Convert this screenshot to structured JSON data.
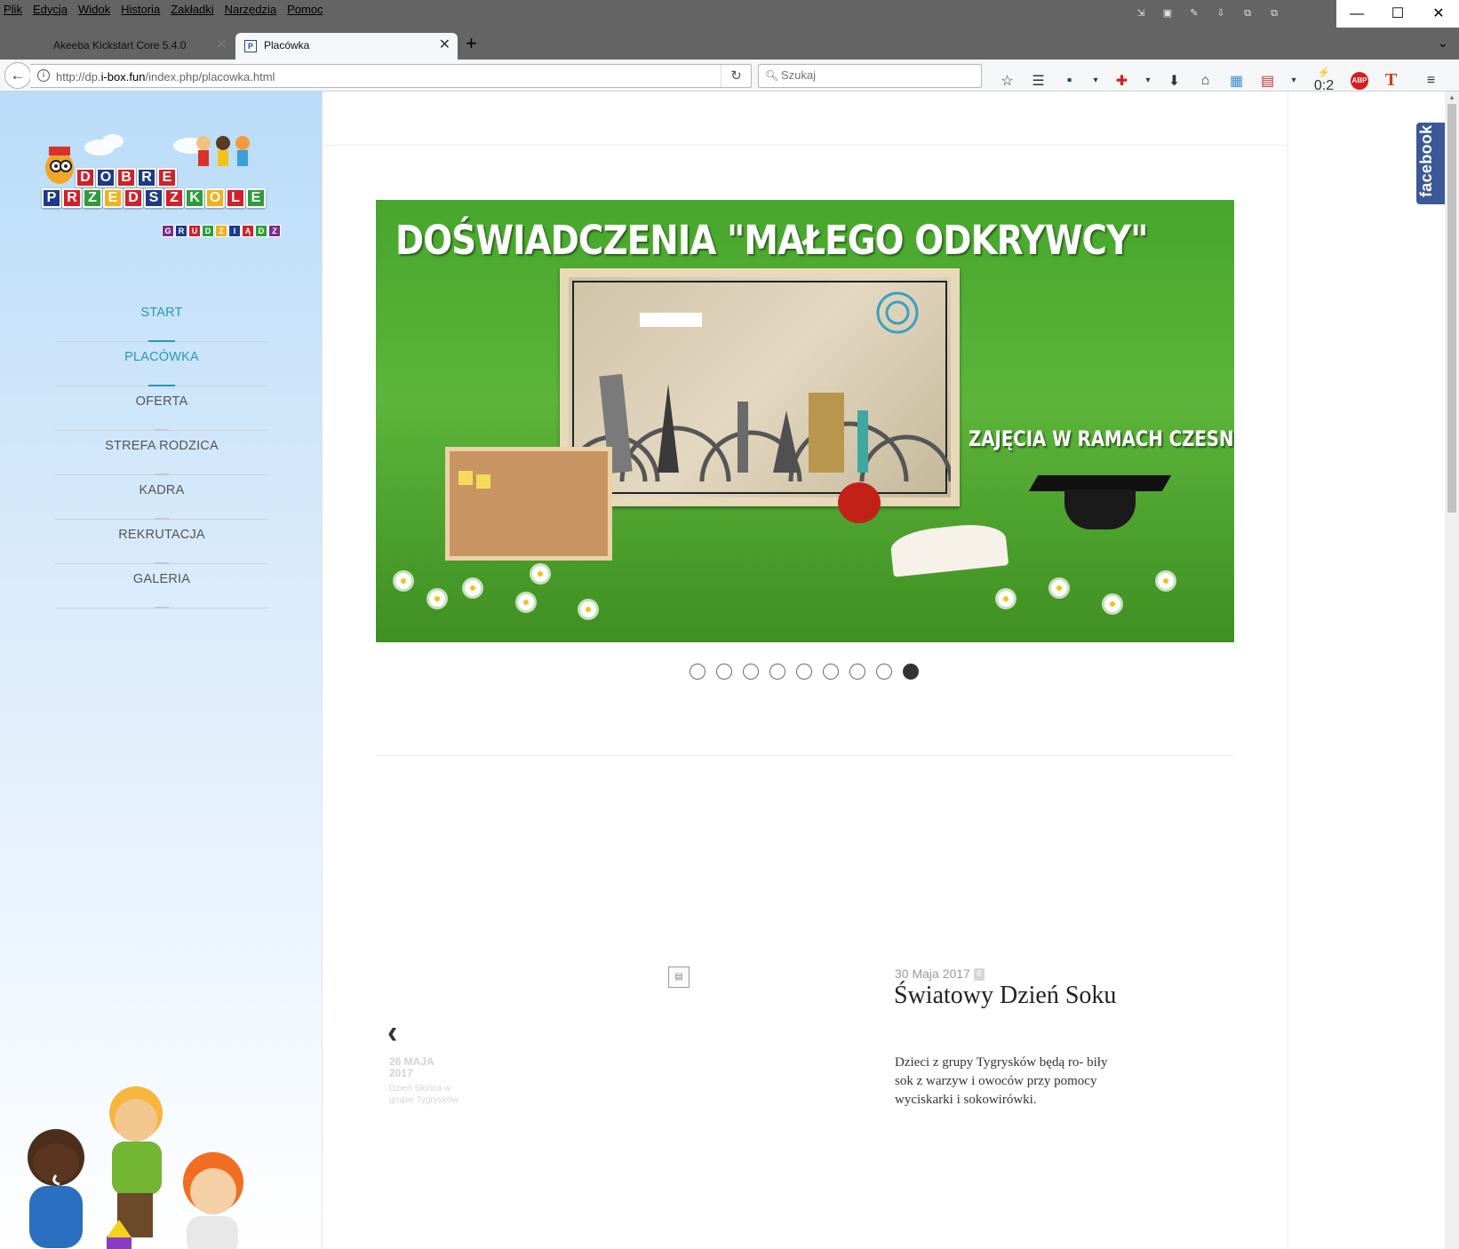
{
  "menubar": {
    "items": [
      "Plik",
      "Edycja",
      "Widok",
      "Historia",
      "Zakładki",
      "Narzędzia",
      "Pomoc"
    ]
  },
  "window_controls": {
    "minimize": "—",
    "maximize": "☐",
    "close": "✕"
  },
  "tabs": [
    {
      "title": "Akeeba Kickstart Core 5.4.0",
      "active": false
    },
    {
      "title": "Placówka",
      "active": true
    }
  ],
  "navbar": {
    "url_prefix": "http://dp.",
    "url_domain": "i-box.fun",
    "url_path": "/index.php/placowka.html",
    "search_placeholder": "Szukaj",
    "counter_label": "0:2",
    "abp_label": "ABP"
  },
  "sidebar": {
    "logo": {
      "word1": [
        "D",
        "O",
        "B",
        "R",
        "E"
      ],
      "word2": [
        "P",
        "R",
        "Z",
        "E",
        "D",
        "S",
        "Z",
        "K",
        "O",
        "L",
        "E"
      ],
      "city": [
        "G",
        "R",
        "U",
        "D",
        "Z",
        "I",
        "Ą",
        "D",
        "Z"
      ]
    },
    "nav": [
      {
        "label": "START",
        "active": true
      },
      {
        "label": "PLACÓWKA",
        "active": true
      },
      {
        "label": "OFERTA",
        "active": false
      },
      {
        "label": "STREFA RODZICA",
        "active": false
      },
      {
        "label": "KADRA",
        "active": false
      },
      {
        "label": "REKRUTACJA",
        "active": false
      },
      {
        "label": "GALERIA",
        "active": false
      }
    ]
  },
  "slider": {
    "title": "DOŚWIADCZENIA \"MAŁEGO ODKRYWCY\"",
    "subtitle": "ZAJĘCIA W RAMACH CZESNEGO",
    "dot_count": 9,
    "active_dot": 9
  },
  "news": {
    "prev": {
      "date": "26 MAJA 2017",
      "title": "Dzień Słońca w grupie Tygrysków"
    },
    "current": {
      "date": "30 Maja 2017",
      "hits": "6",
      "title": "Światowy Dzień Soku",
      "body": "Dzieci z grupy Tygrysków będą ro- biły sok z warzyw i owoców przy pomocy wyciskarki i sokowirówki."
    }
  },
  "facebook_tab": {
    "label": "facebook"
  },
  "colors": {
    "accent": "#2a96b8",
    "facebook": "#3b5998",
    "browser_chrome": "#646464"
  }
}
